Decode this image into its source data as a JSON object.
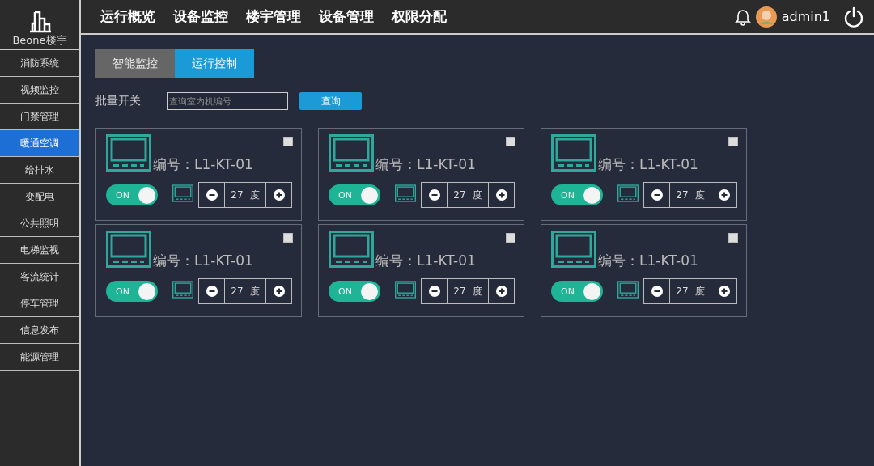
{
  "app": {
    "brand": "Beone楼宇"
  },
  "top_nav": [
    "运行概览",
    "设备监控",
    "楼宇管理",
    "设备管理",
    "权限分配"
  ],
  "user": {
    "name": "admin1"
  },
  "sidebar": {
    "items": [
      {
        "label": "消防系统",
        "selected": false
      },
      {
        "label": "视频监控",
        "selected": false
      },
      {
        "label": "门禁管理",
        "selected": false
      },
      {
        "label": "暖通空调",
        "selected": true
      },
      {
        "label": "给排水",
        "selected": false
      },
      {
        "label": "变配电",
        "selected": false
      },
      {
        "label": "公共照明",
        "selected": false
      },
      {
        "label": "电梯监视",
        "selected": false
      },
      {
        "label": "客流统计",
        "selected": false
      },
      {
        "label": "停车管理",
        "selected": false
      },
      {
        "label": "信息发布",
        "selected": false
      },
      {
        "label": "能源管理",
        "selected": false
      }
    ]
  },
  "tabs": [
    {
      "label": "智能监控",
      "selected": false
    },
    {
      "label": "运行控制",
      "selected": true
    }
  ],
  "batch": {
    "label": "批量开关",
    "search": {
      "placeholder": "查询室内机编号"
    },
    "query_button": "查询"
  },
  "units": [
    {
      "code": "编号：L1-KT-01",
      "checked": false,
      "on": true,
      "switch_label": "ON",
      "temperature": "27",
      "unit": "度"
    },
    {
      "code": "编号：L1-KT-01",
      "checked": false,
      "on": true,
      "switch_label": "ON",
      "temperature": "27",
      "unit": "度"
    },
    {
      "code": "编号：L1-KT-01",
      "checked": false,
      "on": true,
      "switch_label": "ON",
      "temperature": "27",
      "unit": "度"
    },
    {
      "code": "编号：L1-KT-01",
      "checked": false,
      "on": true,
      "switch_label": "ON",
      "temperature": "27",
      "unit": "度"
    },
    {
      "code": "编号：L1-KT-01",
      "checked": false,
      "on": true,
      "switch_label": "ON",
      "temperature": "27",
      "unit": "度"
    },
    {
      "code": "编号：L1-KT-01",
      "checked": false,
      "on": true,
      "switch_label": "ON",
      "temperature": "27",
      "unit": "度"
    }
  ]
}
